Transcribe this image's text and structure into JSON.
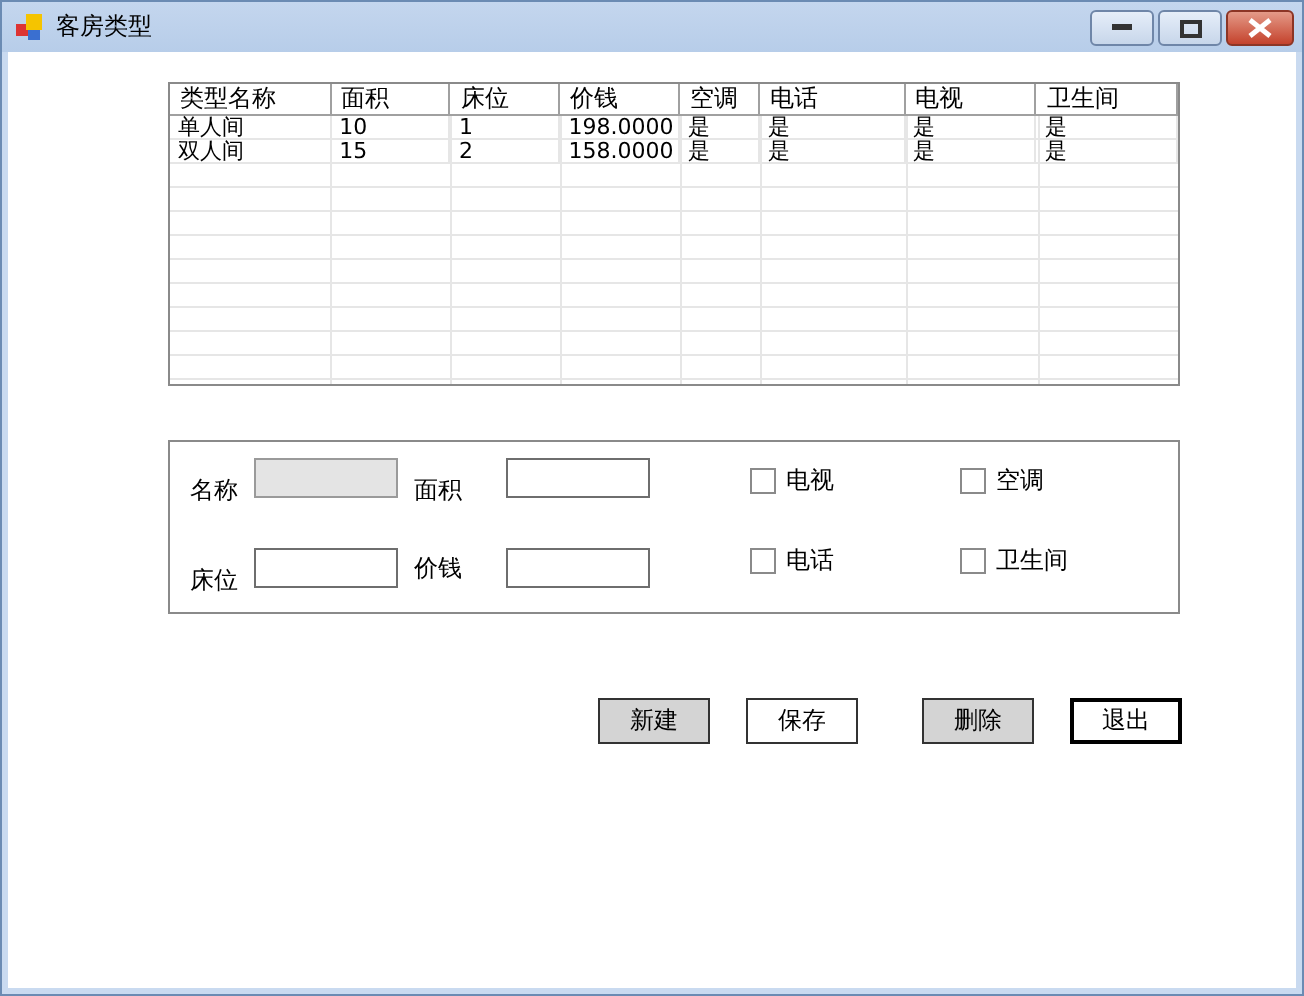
{
  "window": {
    "title": "客房类型"
  },
  "table": {
    "columns": [
      "类型名称",
      "面积",
      "床位",
      "价钱",
      "空调",
      "电话",
      "电视",
      "卫生间"
    ],
    "rows": [
      [
        "单人间",
        "10",
        "1",
        "198.0000",
        "是",
        "是",
        "是",
        "是"
      ],
      [
        "双人间",
        "15",
        "2",
        "158.0000",
        "是",
        "是",
        "是",
        "是"
      ]
    ]
  },
  "form": {
    "fields": [
      {
        "label": "名称",
        "disabled": true
      },
      {
        "label": "面积",
        "disabled": false
      },
      {
        "label": "床位",
        "disabled": false
      },
      {
        "label": "价钱",
        "disabled": false
      }
    ],
    "checkboxes": [
      {
        "label": "电视",
        "checked": false
      },
      {
        "label": "空调",
        "checked": false
      },
      {
        "label": "电话",
        "checked": false
      },
      {
        "label": "卫生间",
        "checked": false
      }
    ]
  },
  "buttons": [
    {
      "label": "新建",
      "shaded": true,
      "default": false
    },
    {
      "label": "保存",
      "shaded": false,
      "default": false
    },
    {
      "label": "删除",
      "shaded": true,
      "default": false
    },
    {
      "label": "退出",
      "shaded": false,
      "default": true
    }
  ]
}
